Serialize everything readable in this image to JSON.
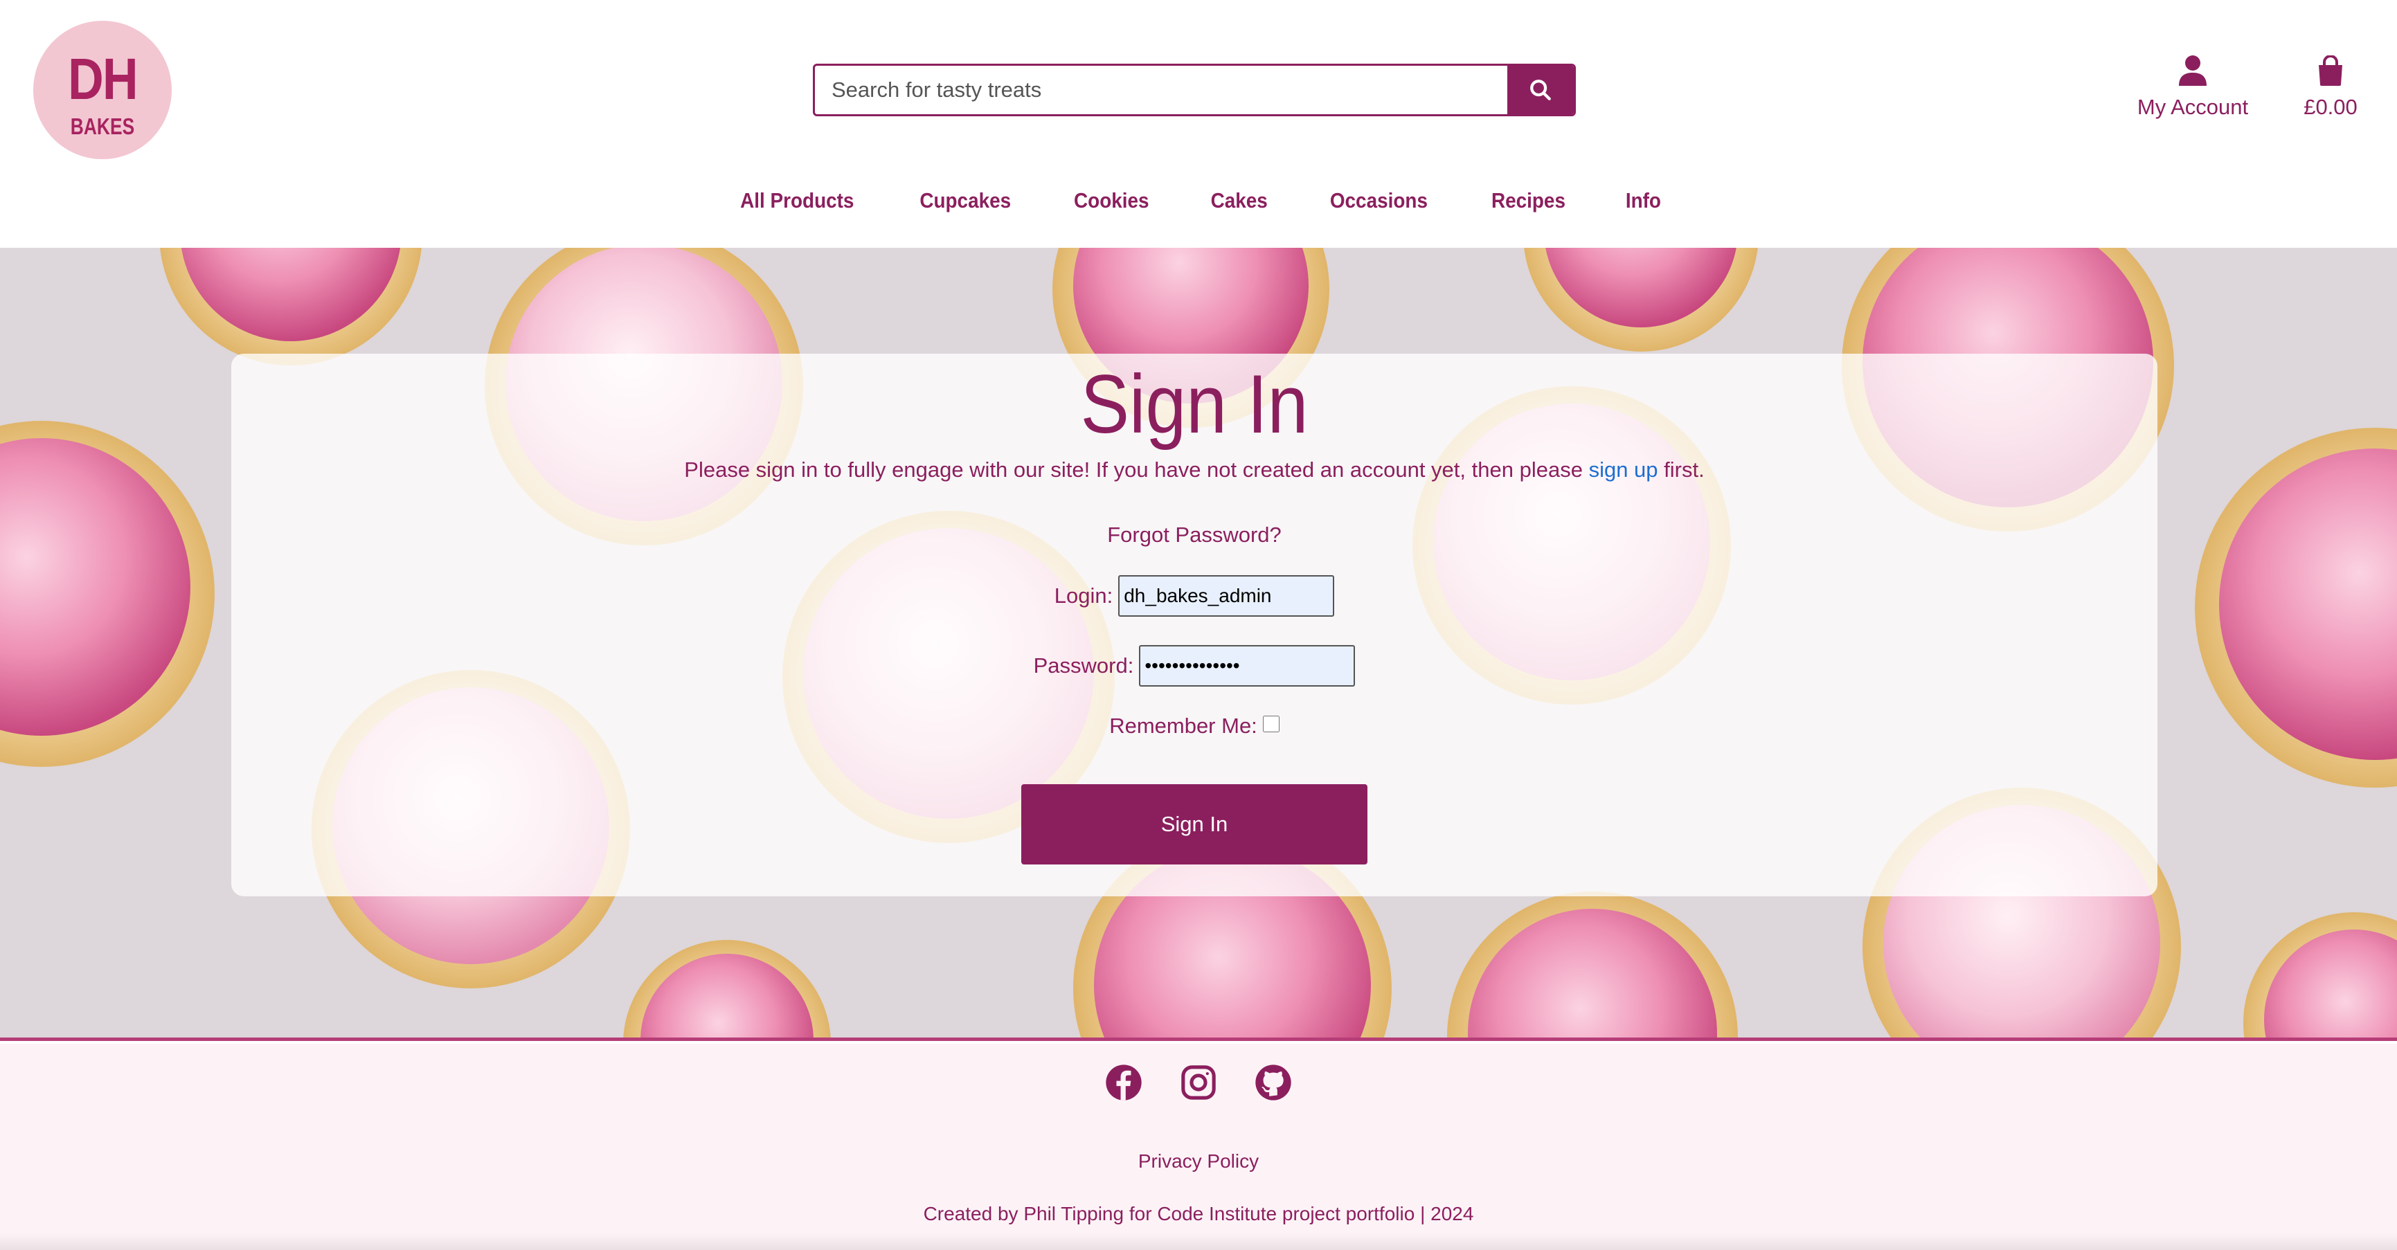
{
  "logo": {
    "line1": "DH",
    "line2": "BAKES"
  },
  "search": {
    "placeholder": "Search for tasty treats",
    "button_icon": "search-icon"
  },
  "account": {
    "label": "My Account",
    "icon": "user-icon"
  },
  "bag": {
    "total": "£0.00",
    "icon": "shopping-bag-icon"
  },
  "nav": {
    "items": [
      {
        "label": "All Products"
      },
      {
        "label": "Cupcakes"
      },
      {
        "label": "Cookies"
      },
      {
        "label": "Cakes"
      },
      {
        "label": "Occasions"
      },
      {
        "label": "Recipes"
      },
      {
        "label": "Info"
      }
    ]
  },
  "signin": {
    "title": "Sign In",
    "intro_before": "Please sign in to fully engage with our site! If you have not created an account yet, then please ",
    "intro_link": "sign up",
    "intro_after": " first.",
    "forgot": "Forgot Password?",
    "login_label": "Login:",
    "login_value": "dh_bakes_admin",
    "password_label": "Password:",
    "password_value": "••••••••••••••",
    "remember_label": "Remember Me:",
    "remember_checked": false,
    "button": "Sign In"
  },
  "footer": {
    "social": [
      "facebook-icon",
      "instagram-icon",
      "github-icon"
    ],
    "privacy": "Privacy Policy",
    "credit": "Created by Phil Tipping for Code Institute project portfolio | 2024"
  },
  "colors": {
    "brand": "#8b1f5e",
    "logo_bg": "#f2c7d2",
    "link": "#1e6ed0",
    "footer_bg": "#fdf3f7"
  }
}
